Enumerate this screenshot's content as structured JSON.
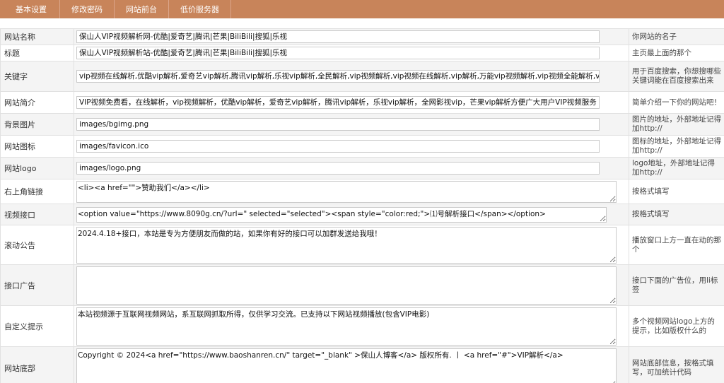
{
  "nav": {
    "tabs": [
      "基本设置",
      "修改密码",
      "网站前台",
      "低价服务器"
    ]
  },
  "rows": [
    {
      "label": "网站名称",
      "value": "保山人VIP视频解析网-优酷|爱奇艺|腾讯|芒果|BiliBili|搜狐|乐视",
      "tip": "你网站的名子"
    },
    {
      "label": "标题",
      "value": "保山人VIP视频解析站-优酷|爱奇艺|腾讯|芒果|BiliBili|搜狐|乐视",
      "tip": "主页最上面的那个"
    },
    {
      "label": "关键字",
      "value": "vip视频在线解析,优酷vip解析,爱奇艺vip解析,腾讯vip解析,乐视vip解析,全民解析,vip视频解析,vip视频在线解析,vip解析,万能vip视频解析,vip视频全能解析,vip",
      "tip": "用于百度搜索，你想搜哪些关键词能在百度搜索出来"
    },
    {
      "label": "网站简介",
      "value": "VIP视频免费看，在线解析，vip视频解析，优酷vip解析，爱奇艺vip解析，腾讯vip解析，乐视vip解析，全网影视vip，芒果vip解析方便广大用户VIP视频服务",
      "tip": "简单介绍一下你的网站吧！"
    },
    {
      "label": "背景图片",
      "value": "images/bgimg.png",
      "tip": "图片的地址，外部地址记得加http://"
    },
    {
      "label": "网站图标",
      "value": "images/favicon.ico",
      "tip": "图标的地址，外部地址记得加http://"
    },
    {
      "label": "网站logo",
      "value": "images/logo.png",
      "tip": "logo地址，外部地址记得加http://"
    },
    {
      "label": "右上角链接",
      "value": "<li><a href=\"\">赞助我们</a></li>",
      "tip": "按格式填写"
    },
    {
      "label": "视频接口",
      "value": "<option value=\"https://www.8090g.cn/?url=\" selected=\"selected\"><span style=\"color:red;\">⑴号解析接口</span></option>",
      "tip": "按格式填写"
    },
    {
      "label": "滚动公告",
      "value": "2024.4.18+接口，本站是专为方便朋友而做的站，如果你有好的接口可以加群发送给我哦！",
      "tip": "播放窗口上方一直在动的那个"
    },
    {
      "label": "接口广告",
      "value": "",
      "tip": "接口下面的广告位，用li标签"
    },
    {
      "label": "自定义提示",
      "value": "本站视频源于互联网视频网站，系互联网抓取所得，仅供学习交流。已支持以下网站视频播放(包含VIP电影)",
      "tip": "多个视频网站logo上方的提示，比如版权什么的"
    },
    {
      "label": "网站底部",
      "value": "Copyright © 2024<a href=\"https://www.baoshanren.cn/\" target=\"_blank\" >保山人博客</a> 版权所有. 丨 <a href=\"#\">VIP解析</a>",
      "tip": "网站底部信息，按格式填写，可加统计代码"
    }
  ]
}
